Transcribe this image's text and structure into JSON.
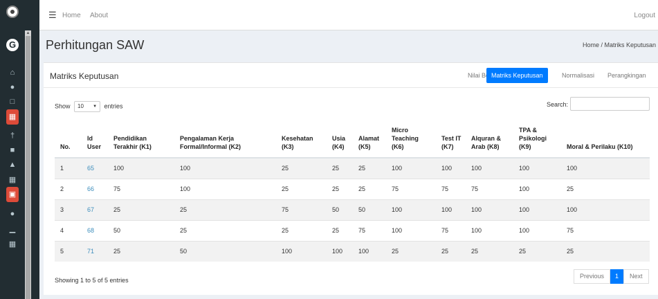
{
  "topbar": {
    "home": "Home",
    "about": "About",
    "logout": "Logout"
  },
  "header": {
    "title": "Perhitungan SAW",
    "breadcrumb": "Home / Matriks Keputusan"
  },
  "card": {
    "title": "Matriks Keputusan",
    "tabs": [
      {
        "label": "Nilai Bobot"
      },
      {
        "label": "Matriks Keputusan",
        "active": true
      },
      {
        "label": "Normalisasi"
      },
      {
        "label": "Perangkingan"
      }
    ]
  },
  "controls": {
    "show_label": "Show",
    "show_value": "10",
    "entries_label": "entries",
    "search_label": "Search:",
    "search_value": ""
  },
  "table": {
    "headers": [
      "No.",
      "Id User",
      "Pendidikan Terakhir (K1)",
      "Pengalaman Kerja Formal/Informal (K2)",
      "Kesehatan (K3)",
      "Usia (K4)",
      "Alamat (K5)",
      "Micro Teaching (K6)",
      "Test IT (K7)",
      "Alquran & Arab (K8)",
      "TPA & Psikologi (K9)",
      "Moral & Perilaku (K10)"
    ],
    "rows": [
      [
        "1",
        "65",
        "100",
        "100",
        "25",
        "25",
        "25",
        "100",
        "100",
        "100",
        "100",
        "100"
      ],
      [
        "2",
        "66",
        "75",
        "100",
        "25",
        "25",
        "25",
        "75",
        "75",
        "75",
        "100",
        "25"
      ],
      [
        "3",
        "67",
        "25",
        "25",
        "75",
        "50",
        "50",
        "100",
        "100",
        "100",
        "100",
        "100"
      ],
      [
        "4",
        "68",
        "50",
        "25",
        "25",
        "25",
        "75",
        "100",
        "75",
        "100",
        "100",
        "75"
      ],
      [
        "5",
        "71",
        "25",
        "50",
        "100",
        "100",
        "100",
        "25",
        "25",
        "25",
        "25",
        "25"
      ]
    ]
  },
  "footer": {
    "info": "Showing 1 to 5 of 5 entries",
    "previous": "Previous",
    "page": "1",
    "next": "Next"
  },
  "colors": {
    "sidebar": "#222d32",
    "accent": "#007bff",
    "active_icon": "#dd4b39",
    "link": "#3c8dbc"
  },
  "sidebar_icons": [
    "home-icon",
    "user-icon",
    "document-icon",
    "calculator-icon",
    "person-icon",
    "save-icon",
    "bank-icon",
    "calculator-icon",
    "briefcase-icon",
    "user-icon",
    "chart-icon",
    "calculator-icon"
  ]
}
